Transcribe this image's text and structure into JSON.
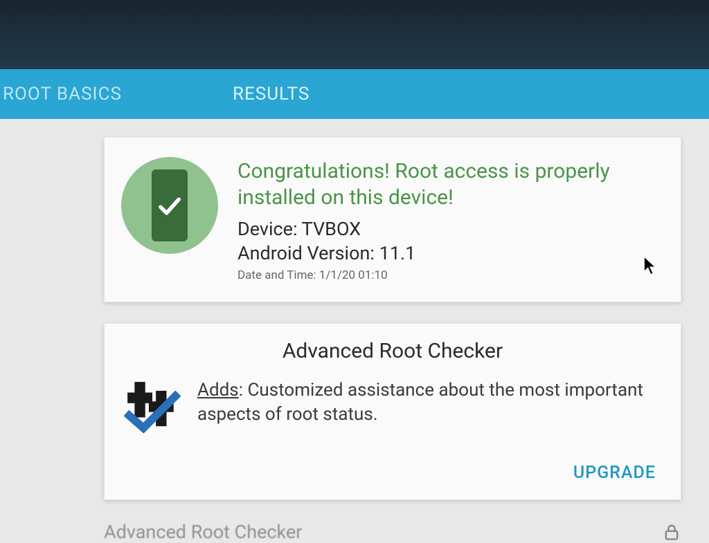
{
  "tabs": {
    "root_basics": "ROOT BASICS",
    "results": "RESULTS"
  },
  "status": {
    "headline": "Congratulations! Root access is properly installed on this device!",
    "device_label": "Device:",
    "device_value": "TVBOX",
    "version_label": "Android Version:",
    "version_value": "11.1",
    "datetime_label": "Date and Time:",
    "datetime_value": "1/1/20 01:10"
  },
  "advanced": {
    "title": "Advanced Root Checker",
    "adds_label": "Adds",
    "description": ": Customized assistance about the most important aspects of root status.",
    "upgrade": "UPGRADE"
  },
  "peek": {
    "title": "Advanced Root Checker"
  },
  "colors": {
    "accent": "#29a6d4",
    "success": "#4a9448"
  }
}
